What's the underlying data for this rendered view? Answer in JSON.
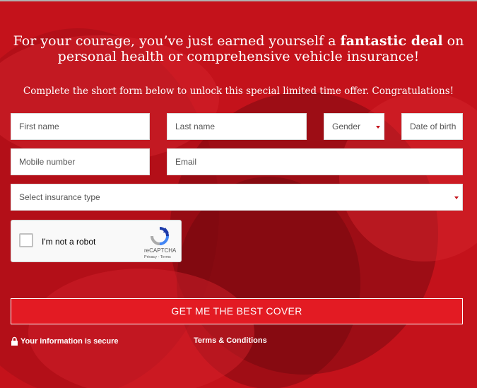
{
  "headline": {
    "part1": "For your courage, you’ve just earned yourself a",
    "bold": "fantastic deal",
    "part2": "on",
    "line2": "personal health or comprehensive vehicle insurance!"
  },
  "subheadline": "Complete the short form below to unlock this special limited time offer. Congratulations!",
  "form": {
    "first_name_placeholder": "First name",
    "last_name_placeholder": "Last name",
    "gender_placeholder": "Gender",
    "dob_placeholder": "Date of birth",
    "mobile_placeholder": "Mobile number",
    "email_placeholder": "Email",
    "insurance_type_placeholder": "Select insurance type"
  },
  "captcha": {
    "label": "I'm not a robot",
    "brand": "reCAPTCHA",
    "links": "Privacy - Terms"
  },
  "cta_label": "GET ME THE BEST COVER",
  "footer": {
    "secure_text": "Your information is secure",
    "terms_link": "Terms & Conditions"
  },
  "colors": {
    "background": "#c4121b",
    "button": "#e31b23",
    "text": "#ffffff"
  },
  "icons": [
    "lock-icon",
    "dropdown-caret-icon",
    "recaptcha-logo-icon"
  ]
}
